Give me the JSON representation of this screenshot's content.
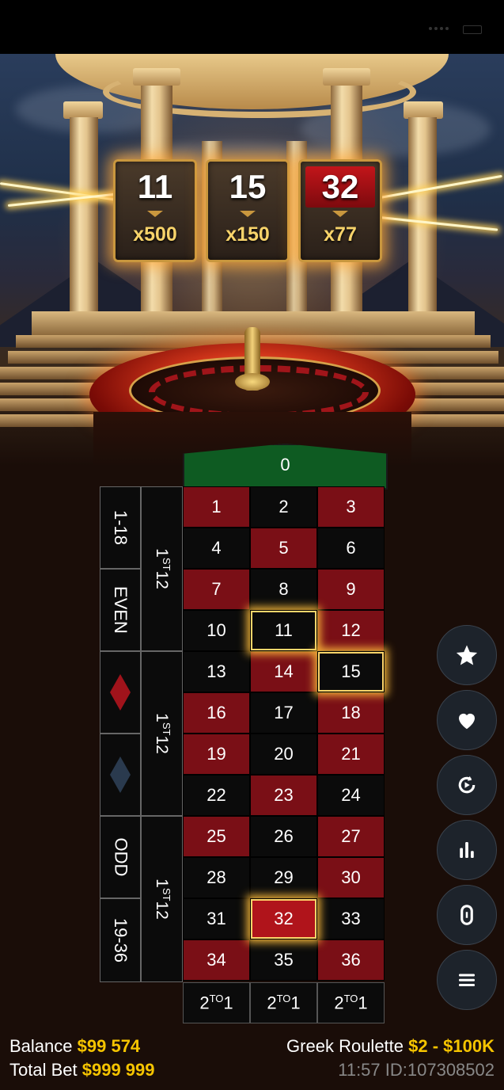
{
  "lucky_numbers": [
    {
      "number": "11",
      "multiplier": "x500",
      "color": "black"
    },
    {
      "number": "15",
      "multiplier": "x150",
      "color": "black"
    },
    {
      "number": "32",
      "multiplier": "x77",
      "color": "red"
    }
  ],
  "table": {
    "zero": "0",
    "rows": [
      [
        "1",
        "2",
        "3"
      ],
      [
        "4",
        "5",
        "6"
      ],
      [
        "7",
        "8",
        "9"
      ],
      [
        "10",
        "11",
        "12"
      ],
      [
        "13",
        "14",
        "15"
      ],
      [
        "16",
        "17",
        "18"
      ],
      [
        "19",
        "20",
        "21"
      ],
      [
        "22",
        "23",
        "24"
      ],
      [
        "25",
        "26",
        "27"
      ],
      [
        "28",
        "29",
        "30"
      ],
      [
        "31",
        "32",
        "33"
      ],
      [
        "34",
        "35",
        "36"
      ]
    ],
    "outside": {
      "low": "1-18",
      "even": "EVEN",
      "odd": "ODD",
      "high": "19-36",
      "red_icon": "red-diamond-icon",
      "black_icon": "black-diamond-icon"
    },
    "dozen_prefix": "1",
    "dozen_suffix": "ST",
    "dozen_num": "12",
    "column_prefix": "2",
    "column_suffix": "TO",
    "column_num": "1"
  },
  "side_buttons": [
    {
      "name": "favorites-star-button",
      "icon": "star-icon"
    },
    {
      "name": "saved-bets-heart-button",
      "icon": "heart-icon"
    },
    {
      "name": "repeat-bet-button",
      "icon": "replay-icon"
    },
    {
      "name": "statistics-button",
      "icon": "bar-chart-icon"
    },
    {
      "name": "racetrack-button",
      "icon": "racetrack-icon"
    },
    {
      "name": "menu-button",
      "icon": "hamburger-icon"
    }
  ],
  "footer": {
    "balance_label": "Balance",
    "balance_value": "$99 574",
    "total_bet_label": "Total Bet",
    "total_bet_value": "$999 999",
    "game_name": "Greek Roulette",
    "limits": "$2 - $100K",
    "time_id": "11:57 ID:107308502"
  },
  "colors": {
    "red": "#7a0f16",
    "black": "#0b0b0b",
    "green": "#0e5b22",
    "accent_gold": "#f5c400"
  }
}
